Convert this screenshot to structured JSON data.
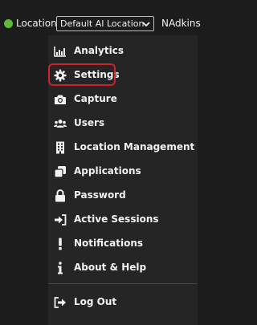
{
  "header": {
    "location_label": "Location:",
    "location_value": "Default AI Location",
    "username": "NAdkins",
    "status_color": "#5fb83a"
  },
  "menu": {
    "items": [
      {
        "label": "Analytics",
        "icon": "bar-chart-icon"
      },
      {
        "label": "Settings",
        "icon": "gear-icon",
        "highlighted": true
      },
      {
        "label": "Capture",
        "icon": "camera-icon"
      },
      {
        "label": "Users",
        "icon": "users-icon"
      },
      {
        "label": "Location Management",
        "icon": "building-icon"
      },
      {
        "label": "Applications",
        "icon": "clone-icon"
      },
      {
        "label": "Password",
        "icon": "lock-icon"
      },
      {
        "label": "Active Sessions",
        "icon": "sign-in-icon"
      },
      {
        "label": "Notifications",
        "icon": "exclamation-icon"
      },
      {
        "label": "About & Help",
        "icon": "info-icon"
      }
    ],
    "logout": {
      "label": "Log Out",
      "icon": "sign-out-icon"
    }
  },
  "colors": {
    "highlight": "#d0222a",
    "menu_bg": "#252525",
    "page_bg": "#1c1c1c"
  }
}
